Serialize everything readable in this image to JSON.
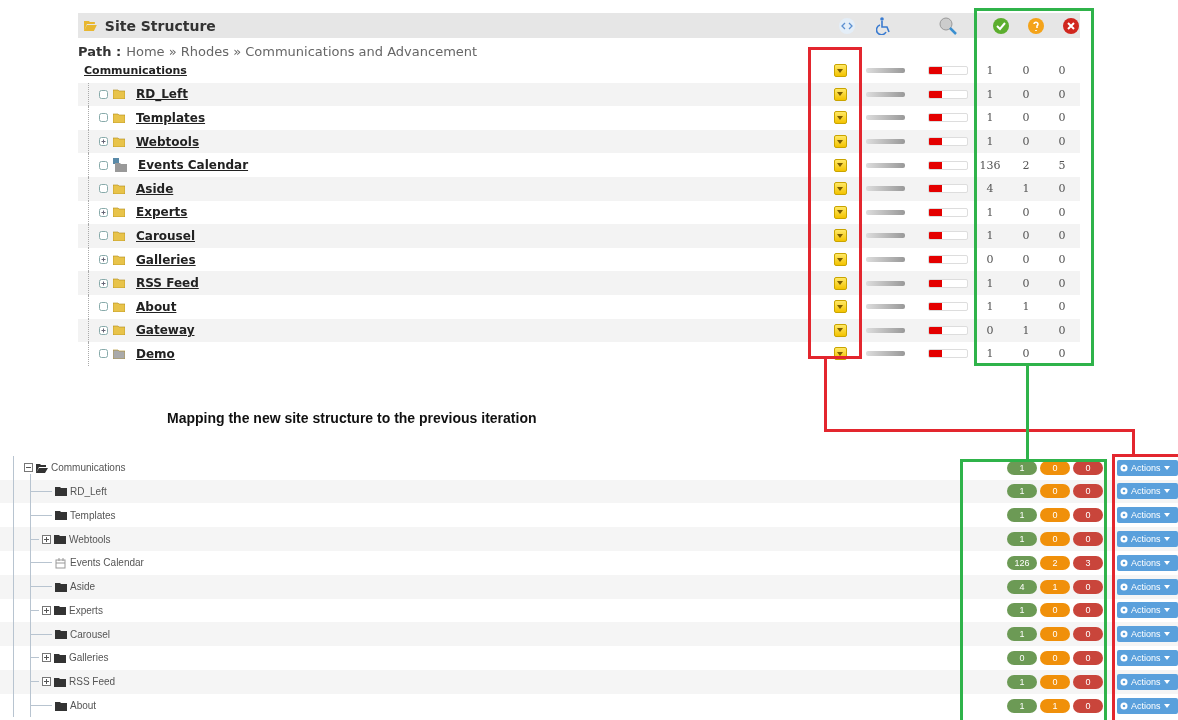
{
  "top": {
    "title": "Site Structure",
    "path_label": "Path :",
    "path": "Home » Rhodes » Communications and Advancement",
    "tree": {
      "name": "Communications",
      "level": 0.33,
      "counts": [
        "1",
        "0",
        "0"
      ],
      "children": [
        {
          "name": "RD_Left",
          "kind": "folder",
          "expandable": false,
          "level": 0.33,
          "counts": [
            "1",
            "0",
            "0"
          ]
        },
        {
          "name": "Templates",
          "kind": "folder",
          "expandable": false,
          "level": 0.33,
          "counts": [
            "1",
            "0",
            "0"
          ]
        },
        {
          "name": "Webtools",
          "kind": "folder",
          "expandable": true,
          "level": 0.33,
          "counts": [
            "1",
            "0",
            "0"
          ]
        },
        {
          "name": "Events Calendar",
          "kind": "calendar",
          "expandable": false,
          "level": 0.33,
          "counts": [
            "136",
            "2",
            "5"
          ]
        },
        {
          "name": "Aside",
          "kind": "folder",
          "expandable": false,
          "level": 0.33,
          "counts": [
            "4",
            "1",
            "0"
          ]
        },
        {
          "name": "Experts",
          "kind": "folder",
          "expandable": true,
          "level": 0.33,
          "counts": [
            "1",
            "0",
            "0"
          ]
        },
        {
          "name": "Carousel",
          "kind": "folder",
          "expandable": false,
          "level": 0.33,
          "counts": [
            "1",
            "0",
            "0"
          ]
        },
        {
          "name": "Galleries",
          "kind": "folder",
          "expandable": true,
          "level": 0.33,
          "counts": [
            "0",
            "0",
            "0"
          ]
        },
        {
          "name": "RSS Feed",
          "kind": "folder",
          "expandable": true,
          "level": 0.33,
          "counts": [
            "1",
            "0",
            "0"
          ]
        },
        {
          "name": "About",
          "kind": "folder",
          "expandable": false,
          "level": 0.33,
          "counts": [
            "1",
            "1",
            "0"
          ]
        },
        {
          "name": "Gateway",
          "kind": "folder",
          "expandable": true,
          "level": 0.33,
          "counts": [
            "0",
            "1",
            "0"
          ]
        },
        {
          "name": "Demo",
          "kind": "folder-muted",
          "expandable": false,
          "level": 0.33,
          "counts": [
            "1",
            "0",
            "0"
          ]
        }
      ]
    }
  },
  "caption": "Mapping the new site structure to the previous iteration",
  "bottom": {
    "tree": {
      "name": "Communications",
      "expanded": true,
      "counts": [
        "1",
        "0",
        "0"
      ],
      "action": "Actions",
      "children": [
        {
          "name": "RD_Left",
          "kind": "folder",
          "expandable": false,
          "counts": [
            "1",
            "0",
            "0"
          ],
          "action": "Actions"
        },
        {
          "name": "Templates",
          "kind": "folder",
          "expandable": false,
          "counts": [
            "1",
            "0",
            "0"
          ],
          "action": "Actions"
        },
        {
          "name": "Webtools",
          "kind": "folder",
          "expandable": true,
          "counts": [
            "1",
            "0",
            "0"
          ],
          "action": "Actions"
        },
        {
          "name": "Events Calendar",
          "kind": "calendar",
          "expandable": false,
          "counts": [
            "126",
            "2",
            "3"
          ],
          "action": "Actions"
        },
        {
          "name": "Aside",
          "kind": "folder",
          "expandable": false,
          "counts": [
            "4",
            "1",
            "0"
          ],
          "action": "Actions"
        },
        {
          "name": "Experts",
          "kind": "folder",
          "expandable": true,
          "counts": [
            "1",
            "0",
            "0"
          ],
          "action": "Actions"
        },
        {
          "name": "Carousel",
          "kind": "folder",
          "expandable": false,
          "counts": [
            "1",
            "0",
            "0"
          ],
          "action": "Actions"
        },
        {
          "name": "Galleries",
          "kind": "folder",
          "expandable": true,
          "counts": [
            "0",
            "0",
            "0"
          ],
          "action": "Actions"
        },
        {
          "name": "RSS Feed",
          "kind": "folder",
          "expandable": true,
          "counts": [
            "1",
            "0",
            "0"
          ],
          "action": "Actions"
        },
        {
          "name": "About",
          "kind": "folder",
          "expandable": false,
          "counts": [
            "1",
            "1",
            "0"
          ],
          "action": "Actions"
        }
      ]
    }
  },
  "annotations": [
    {
      "color": "#e3262e"
    },
    {
      "color": "#2fb34a"
    }
  ]
}
